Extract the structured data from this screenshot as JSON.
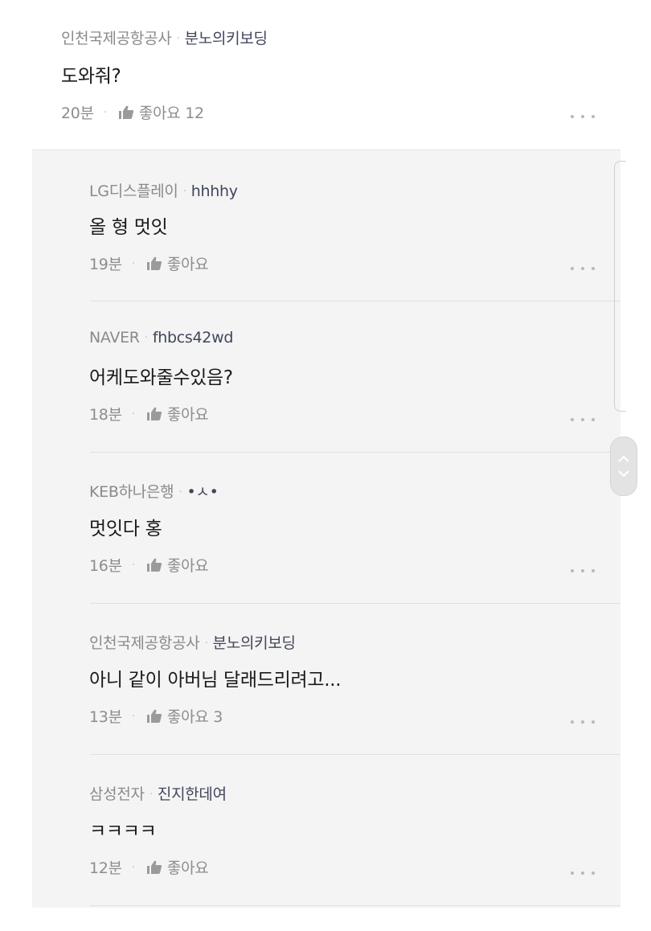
{
  "main_comment": {
    "company": "인천국제공항공사",
    "nickname": "분노의키보딩",
    "text": "도와줘?",
    "time": "20분",
    "like_label": "좋아요 12"
  },
  "replies": [
    {
      "company": "LG디스플레이",
      "nickname": "hhhhy",
      "text": "올 형 멋잇",
      "time": "19분",
      "like_label": "좋아요"
    },
    {
      "company": "NAVER",
      "nickname": "fhbcs42wd",
      "text": "어케도와줄수있음?",
      "time": "18분",
      "like_label": "좋아요"
    },
    {
      "company": "KEB하나은행",
      "nickname": "•ㅅ•",
      "text": "멋잇다 홍",
      "time": "16분",
      "like_label": "좋아요"
    },
    {
      "company": "인천국제공항공사",
      "nickname": "분노의키보딩",
      "text": "아니 같이 아버님 달래드리려고...",
      "time": "13분",
      "like_label": "좋아요 3"
    },
    {
      "company": "삼성전자",
      "nickname": "진지한데여",
      "text": "ㅋㅋㅋㅋ",
      "time": "12분",
      "like_label": "좋아요"
    }
  ],
  "separator": "·",
  "icons": {
    "like": "thumbs-up-icon",
    "more": "more-dots-icon",
    "scroll_up": "chevron-up-icon",
    "scroll_down": "chevron-down-icon"
  },
  "colors": {
    "nickname": "#41465b",
    "meta": "#8a8a8a",
    "reply_background": "#f4f4f4"
  }
}
